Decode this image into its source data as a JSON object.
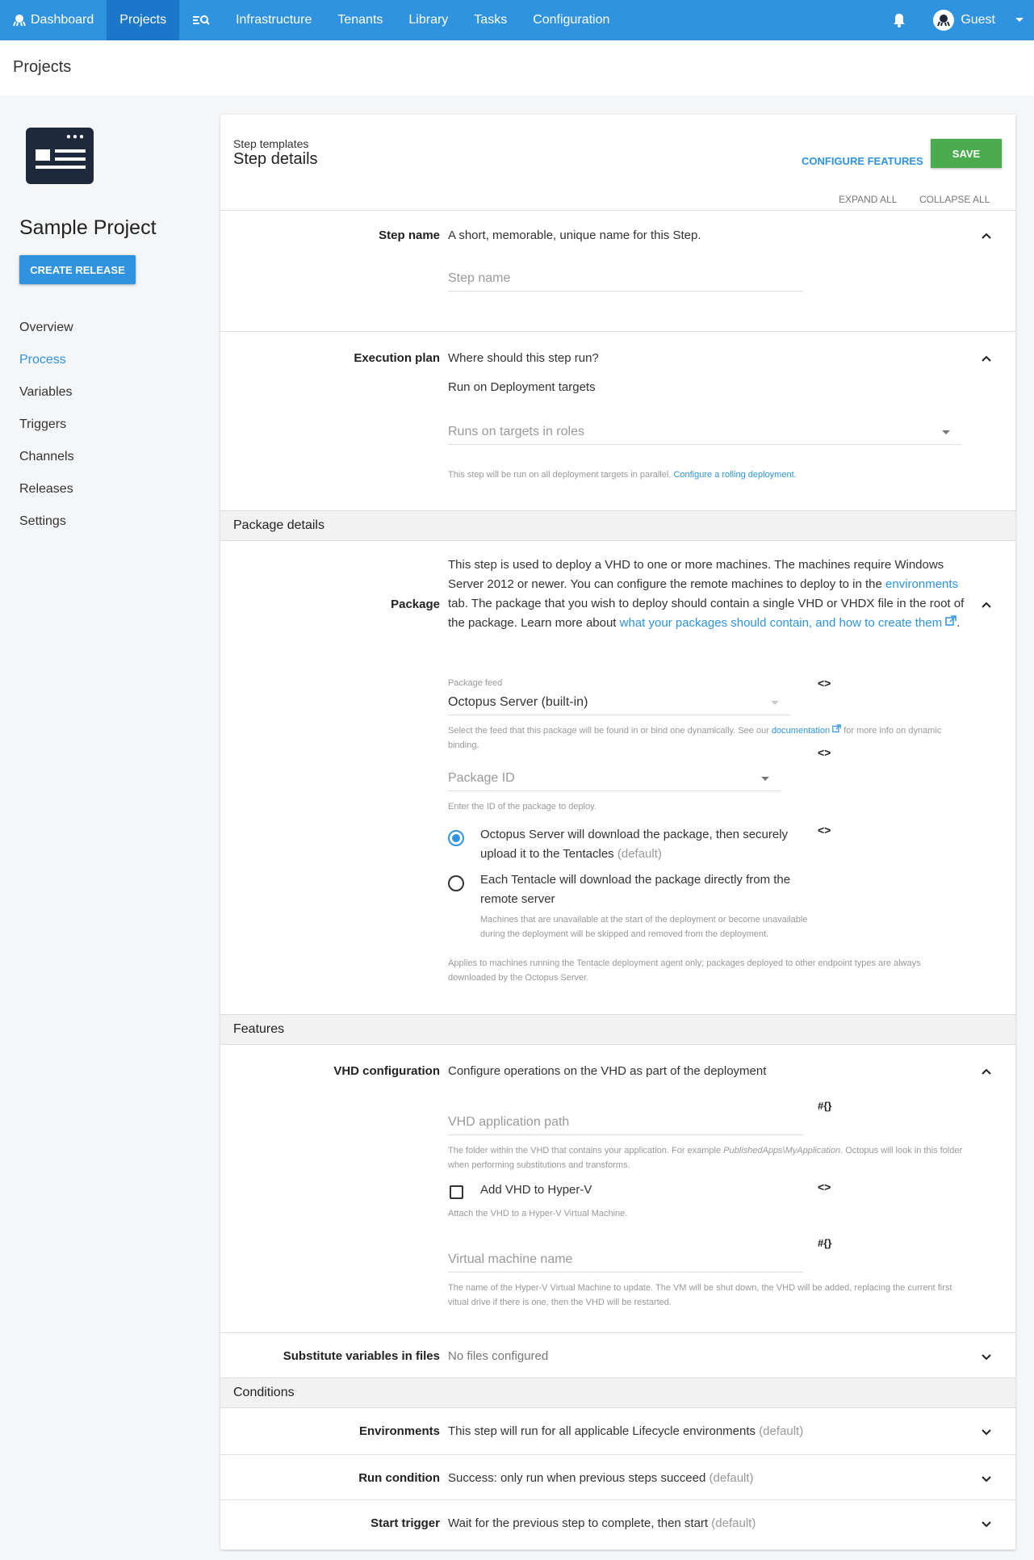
{
  "nav": {
    "items": [
      {
        "label": "Dashboard",
        "active": false
      },
      {
        "label": "Projects",
        "active": true
      },
      {
        "label": "",
        "icon": "search-list-icon"
      },
      {
        "label": "Infrastructure",
        "active": false
      },
      {
        "label": "Tenants",
        "active": false
      },
      {
        "label": "Library",
        "active": false
      },
      {
        "label": "Tasks",
        "active": false
      },
      {
        "label": "Configuration",
        "active": false
      }
    ],
    "user": "Guest"
  },
  "page": {
    "title": "Projects"
  },
  "sidebar": {
    "project_name": "Sample Project",
    "create_release": "CREATE RELEASE",
    "links": [
      "Overview",
      "Process",
      "Variables",
      "Triggers",
      "Channels",
      "Releases",
      "Settings"
    ],
    "active": "Process"
  },
  "card": {
    "breadcrumb": "Step templates",
    "title": "Step details",
    "configure_features": "CONFIGURE FEATURES",
    "save": "SAVE",
    "expand_all": "EXPAND ALL",
    "collapse_all": "COLLAPSE ALL"
  },
  "step_name": {
    "label": "Step name",
    "summary": "A short, memorable, unique name for this Step.",
    "placeholder": "Step name"
  },
  "execution_plan": {
    "label": "Execution plan",
    "summary": "Where should this step run?",
    "target": "Run on Deployment targets",
    "roles_placeholder": "Runs on targets in roles",
    "hint": "This step will be run on all deployment targets in parallel.",
    "hint_link": "Configure a rolling deployment."
  },
  "package_details": {
    "group_title": "Package details",
    "label": "Package",
    "desc_1": "This step is used to deploy a VHD to one or more machines. The machines require Windows Server 2012 or newer. You can configure the remote machines to deploy to in the ",
    "desc_link_1": "environments",
    "desc_2": " tab. The package that you wish to deploy should contain a single VHD or VHDX file in the root of the package. Learn more about ",
    "desc_link_2": "what your packages should contain, and how to create them",
    "desc_3": ".",
    "feed_label": "Package feed",
    "feed_value": "Octopus Server (built-in)",
    "feed_hint_1": "Select the feed that this package will be found in or bind one dynamically. See our ",
    "feed_hint_link": "documentation",
    "feed_hint_2": " for more info on dynamic binding.",
    "package_id_placeholder": "Package ID",
    "package_id_hint": "Enter the ID of the package to deploy.",
    "radio_1": "Octopus Server will download the package, then securely upload it to the Tentacles",
    "radio_1_suffix": "(default)",
    "radio_2": "Each Tentacle will download the package directly from the remote server",
    "radio_2_hint": "Machines that are unavailable at the start of the deployment or become unavailable during the deployment will be skipped and removed from the deployment.",
    "applies_hint": "Applies to machines running the Tentacle deployment agent only; packages deployed to other endpoint types are always downloaded by the Octopus Server.",
    "bind_symbol": "<>"
  },
  "features": {
    "group_title": "Features",
    "vhd_label": "VHD configuration",
    "vhd_summary": "Configure operations on the VHD as part of the deployment",
    "vhd_path_placeholder": "VHD application path",
    "vhd_path_hint_1": "The folder within the VHD that contains your application. For example ",
    "vhd_path_hint_em": "PublishedApps\\MyApplication",
    "vhd_path_hint_2": ". Octopus will look in this folder when performing substitutions and transforms.",
    "hyperv_label": "Add VHD to Hyper-V",
    "hyperv_hint": "Attach the VHD to a Hyper-V Virtual Machine.",
    "vm_name_placeholder": "Virtual machine name",
    "vm_name_hint": "The name of the Hyper-V Virtual Machine to update. The VM will be shut down, the VHD will be added, replacing the current first vitual drive if there is one, then the VHD will be restarted.",
    "var_symbol": "#{}",
    "subst_label": "Substitute variables in files",
    "subst_summary": "No files configured"
  },
  "conditions": {
    "group_title": "Conditions",
    "env_label": "Environments",
    "env_summary": "This step will run for all applicable Lifecycle environments",
    "run_label": "Run condition",
    "run_summary": "Success: only run when previous steps succeed",
    "start_label": "Start trigger",
    "start_summary": "Wait for the previous step to complete, then start",
    "default": "(default)"
  }
}
